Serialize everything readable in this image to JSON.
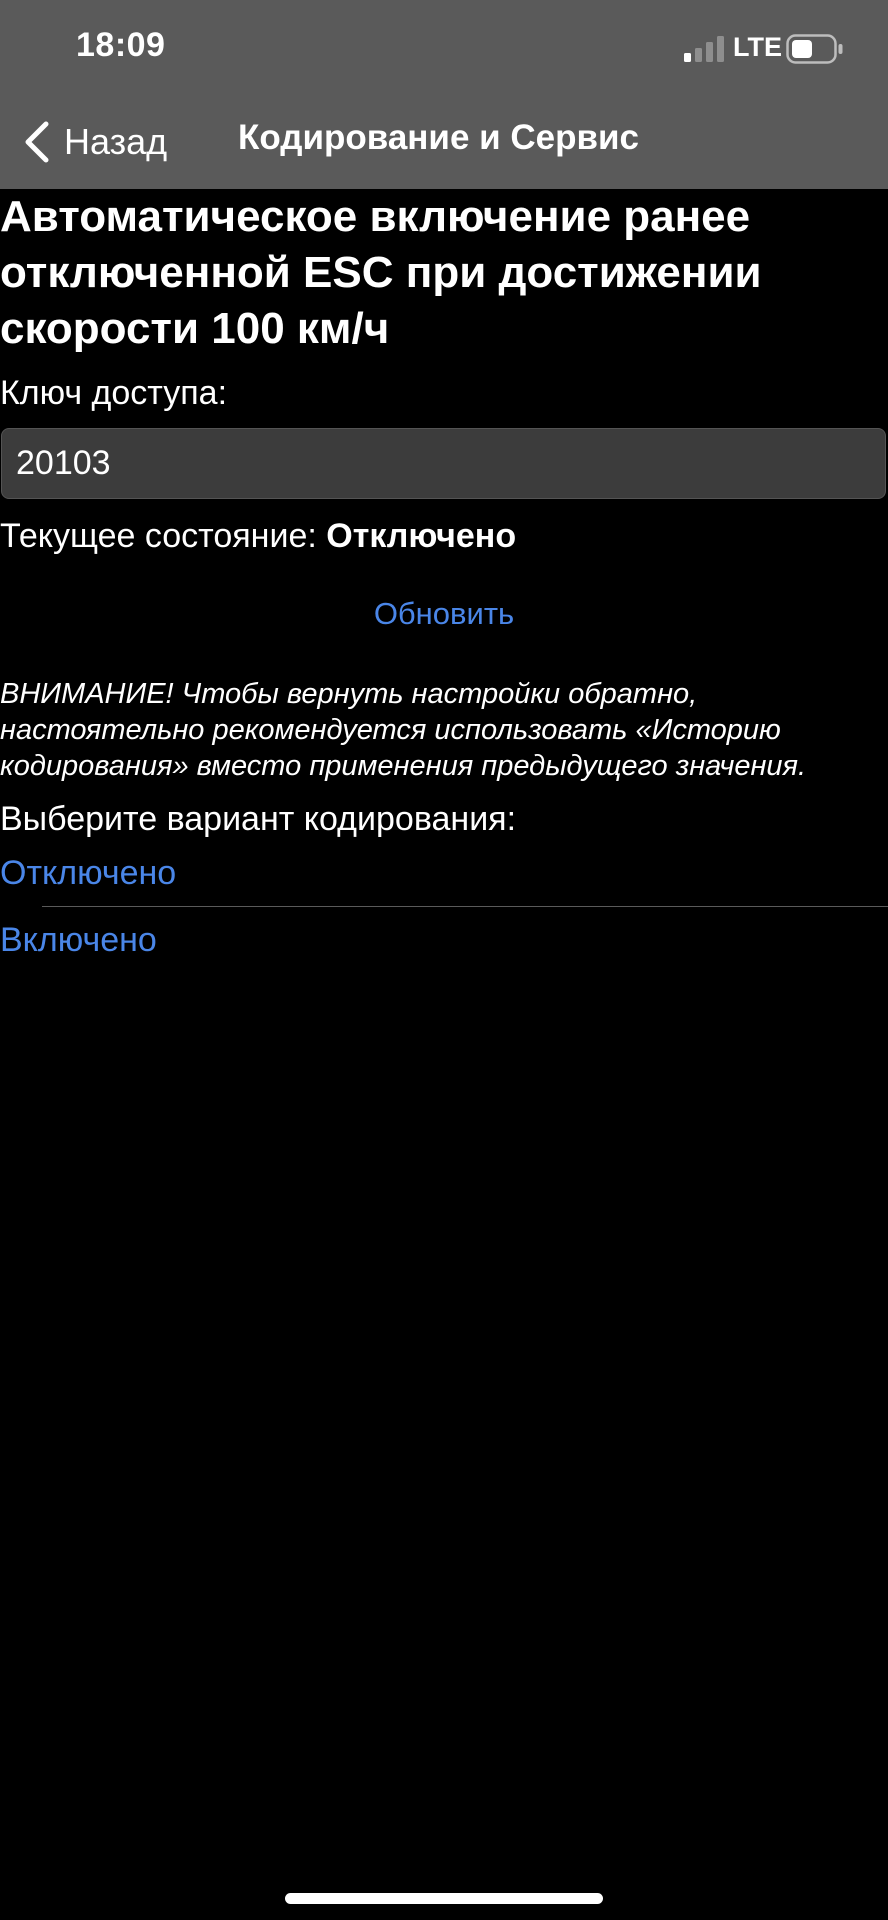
{
  "status_bar": {
    "time": "18:09",
    "carrier": "LTE",
    "signal_icon": "signal-bars-icon",
    "battery_icon": "battery-icon"
  },
  "nav": {
    "back_label": "Назад",
    "back_icon": "chevron-left-icon",
    "title": "Кодирование и Сервис"
  },
  "main": {
    "page_title": "Автоматическое включение ранее отключенной ESC при достижении скорости 100 км/ч",
    "key_label": "Ключ доступа:",
    "key_value": "20103",
    "state_prefix": "Текущее состояние: ",
    "state_value": "Отключено",
    "refresh_label": "Обновить",
    "warning": "ВНИМАНИЕ! Чтобы вернуть настройки обратно, настоятельно рекомендуется использовать «Историю кодирования» вместо применения предыдущего значения.",
    "choose_label": "Выберите вариант кодирования:",
    "options": [
      {
        "label": "Отключено"
      },
      {
        "label": "Включено"
      }
    ]
  },
  "colors": {
    "background": "#000000",
    "top_bar": "#5a5a5a",
    "accent": "#4a86e8",
    "input_background": "#3c3c3c",
    "text": "#ffffff"
  }
}
